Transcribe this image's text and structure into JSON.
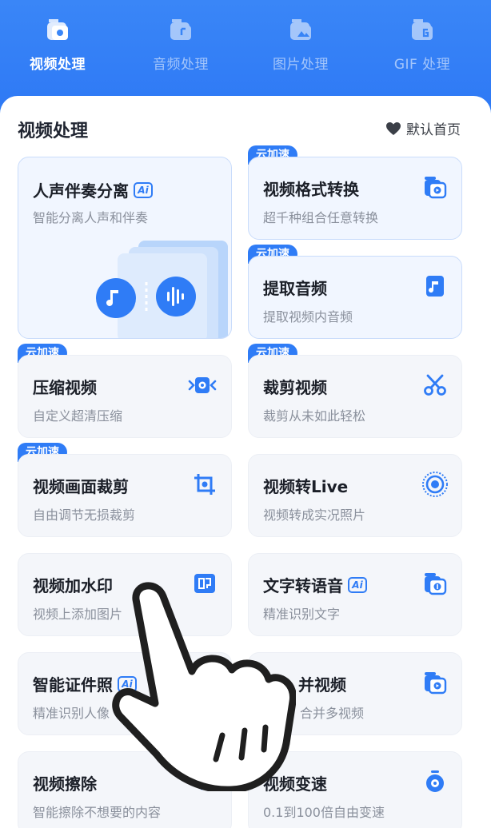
{
  "tabs": [
    {
      "label": "视频处理",
      "icon": "video-folder-icon",
      "active": true
    },
    {
      "label": "音频处理",
      "icon": "audio-folder-icon",
      "active": false
    },
    {
      "label": "图片处理",
      "icon": "image-folder-icon",
      "active": false
    },
    {
      "label": "GIF 处理",
      "icon": "gif-folder-icon",
      "active": false
    }
  ],
  "section": {
    "title": "视频处理",
    "default_home": "默认首页"
  },
  "cloud_tag": "云加速",
  "ai_badge": "Ai",
  "big_card": {
    "title": "人声伴奏分离",
    "subtitle": "智能分离人声和伴奏"
  },
  "cards": [
    {
      "title": "视频格式转换",
      "subtitle": "超千种组合任意转换",
      "icon": "video-convert-icon"
    },
    {
      "title": "提取音频",
      "subtitle": "提取视频内音频",
      "icon": "music-file-icon"
    },
    {
      "title": "压缩视频",
      "subtitle": "自定义超清压缩",
      "icon": "compress-icon"
    },
    {
      "title": "裁剪视频",
      "subtitle": "裁剪从未如此轻松",
      "icon": "scissors-icon"
    },
    {
      "title": "视频画面裁剪",
      "subtitle": "自由调节无损裁剪",
      "icon": "crop-icon"
    },
    {
      "title": "视频转Live",
      "subtitle": "视频转成实况照片",
      "icon": "live-photo-icon"
    },
    {
      "title": "视频加水印",
      "subtitle": "视频上添加图片",
      "icon": "stamp-icon"
    },
    {
      "title": "文字转语音",
      "subtitle": "精准识别文字",
      "icon": "text-to-speech-icon"
    },
    {
      "title": "智能证件照",
      "subtitle": "精准识别人像",
      "icon": "id-photo-icon"
    },
    {
      "title": "并视频",
      "subtitle": "合并多视频",
      "icon": "merge-video-icon"
    },
    {
      "title": "视频擦除",
      "subtitle": "智能擦除不想要的内容",
      "icon": "eraser-icon"
    },
    {
      "title": "视频变速",
      "subtitle": "0.1到100倍自由变速",
      "icon": "speed-timer-icon"
    }
  ],
  "colors": {
    "accent": "#2f7cf6",
    "card_bg": "#f4f6fa",
    "text_sub": "#8a909c"
  }
}
